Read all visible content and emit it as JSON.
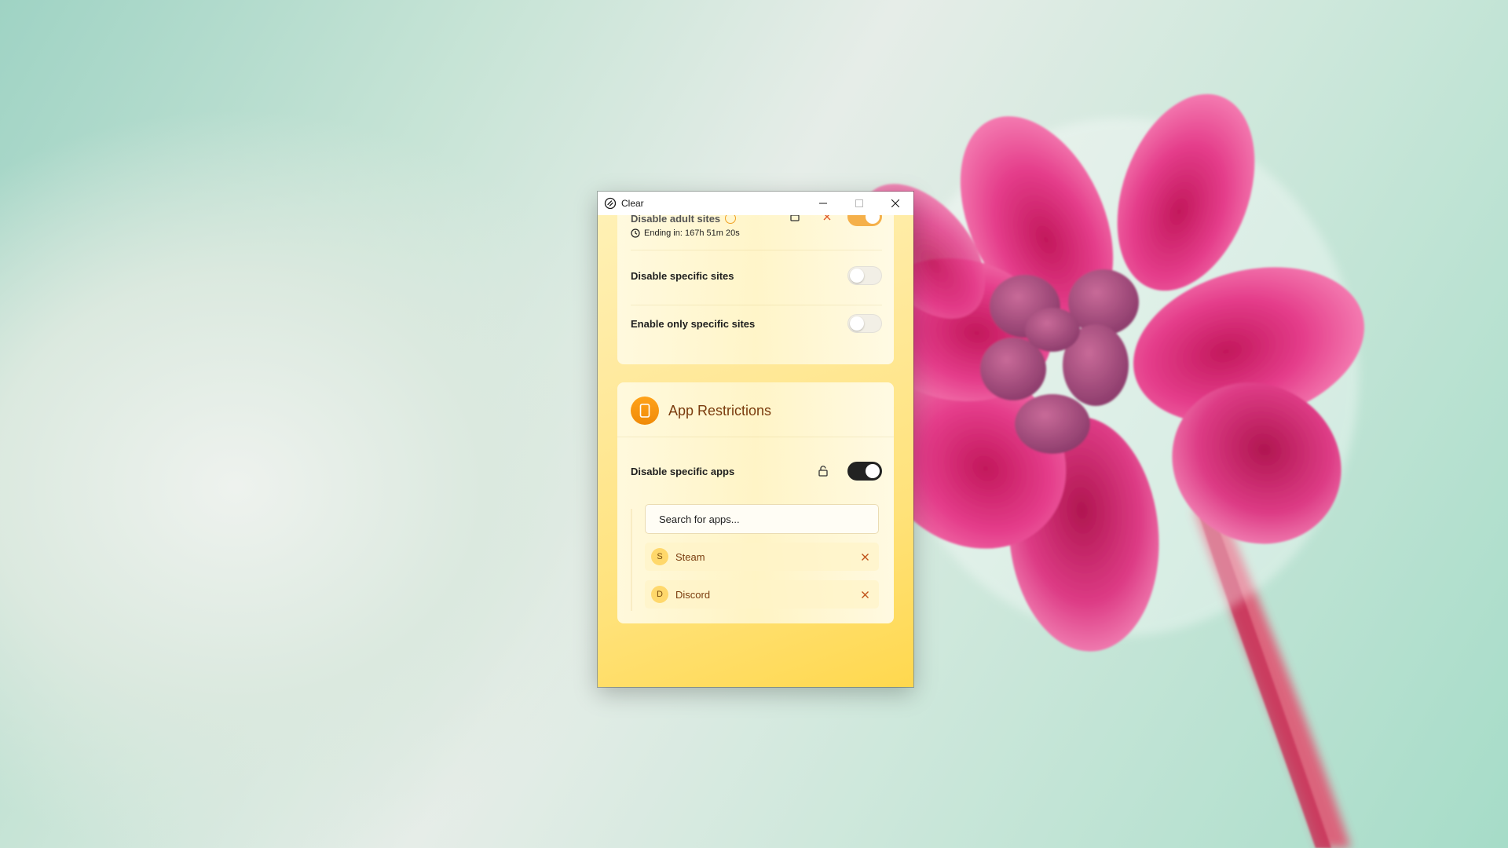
{
  "window": {
    "title": "Clear",
    "controls": [
      "minimize-icon",
      "maximize-icon",
      "close-icon"
    ]
  },
  "web_section": {
    "adult_sites_label": "Disable adult sites",
    "ending_text": "Ending in: 167h 51m 20s",
    "adult_sites_enabled": true,
    "specific_sites_label": "Disable specific sites",
    "specific_sites_enabled": false,
    "only_specific_label": "Enable only specific sites",
    "only_specific_enabled": false
  },
  "app_section": {
    "title": "App Restrictions",
    "icon": "phone-icon",
    "disable_apps_label": "Disable specific apps",
    "disable_apps_enabled": true,
    "search_placeholder": "Search for apps...",
    "apps": [
      {
        "initial": "S",
        "name": "Steam"
      },
      {
        "initial": "D",
        "name": "Discord"
      }
    ]
  },
  "colors": {
    "accent_orange": "#f59a10",
    "title_brown": "#7a3b0d",
    "toggle_dark": "#222222",
    "window_yellow": "#ffe27a"
  }
}
